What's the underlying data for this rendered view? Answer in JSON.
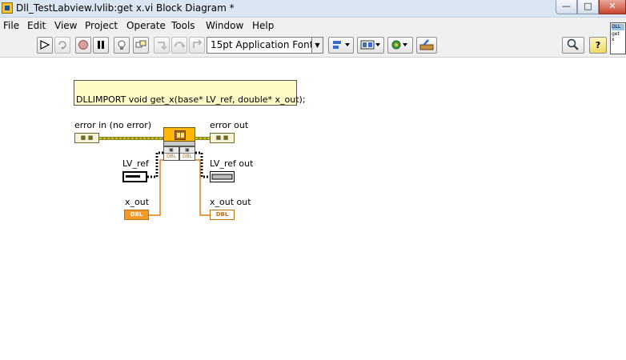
{
  "window": {
    "title": "Dll_TestLabview.lvlib:get x.vi Block Diagram *",
    "controls": {
      "minimize": "—",
      "maximize": "□",
      "close": "✕"
    }
  },
  "menu": [
    "File",
    "Edit",
    "View",
    "Project",
    "Operate",
    "Tools",
    "Window",
    "Help"
  ],
  "toolbar": {
    "run_icon": "run-arrow-icon",
    "run_continuous_icon": "run-continuously-icon",
    "abort_icon": "abort-icon",
    "pause_icon": "pause-icon",
    "highlight_icon": "lightbulb-icon",
    "retain_icon": "retain-wire-values-icon",
    "step_into_icon": "step-into-icon",
    "step_over_icon": "step-over-icon",
    "step_out_icon": "step-out-icon",
    "font": "15pt Application Font",
    "align_icon": "align-objects-icon",
    "distribute_icon": "distribute-objects-icon",
    "reorder_icon": "reorder-icon",
    "cleanup_icon": "clean-up-diagram-icon",
    "search_icon": "search-icon",
    "help_icon": "?"
  },
  "vi_icon": {
    "line1": "DLL",
    "line2": "get",
    "line3": "x"
  },
  "diagram": {
    "comment": "DLLIMPORT void get_x(base* LV_ref, double* x_out);",
    "error_in_label": "error in (no error)",
    "error_out_label": "error out",
    "lv_ref_label": "LV_ref",
    "lv_ref_out_label": "LV_ref out",
    "x_out_label": "x_out",
    "x_out_out_label": "x_out out",
    "dbl_text": "DBL",
    "cluster_text": "■ ■",
    "param_type_text": "DBL"
  },
  "colors": {
    "error_wire": "#8a8a1c",
    "error_wire_accent": "#e8d030",
    "ref_wire": "#000000",
    "dbl_wire": "#e87a10",
    "node_head": "#ffb800",
    "comment_bg": "#fffbc6"
  }
}
